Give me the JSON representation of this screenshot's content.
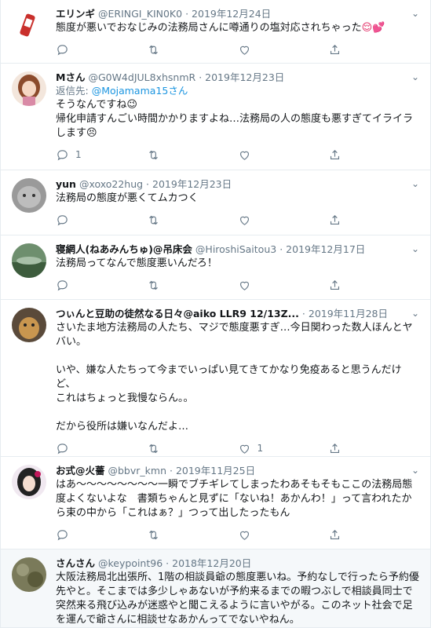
{
  "tweets": [
    {
      "name": "エリンギ",
      "handle": "@ERINGI_KIN0K0",
      "dot": "·",
      "date": "2019年12月24日",
      "reply_prefix": "",
      "reply_mention": "",
      "text": "態度が悪いでおなじみの法務局さんに噂通りの塩対応されちゃった",
      "emoji": "😌💕",
      "reply_count": "",
      "retweet_count": "",
      "like_count": "",
      "avatar_color": "#c9302c"
    },
    {
      "name": "Mさん",
      "handle": "@G0W4dJUL8xhsnmR",
      "dot": "·",
      "date": "2019年12月23日",
      "reply_prefix": "返信先: ",
      "reply_mention": "@Mojamama15さん",
      "text": "そうなんですね😉\n帰化申請すんごい時間かかりますよね…法務局の人の態度も悪すぎてイライラします😣",
      "emoji": "",
      "reply_count": "1",
      "retweet_count": "",
      "like_count": "",
      "avatar_color": "#a0522d"
    },
    {
      "name": "yun",
      "handle": "@xoxo22hug",
      "dot": "·",
      "date": "2019年12月23日",
      "reply_prefix": "",
      "reply_mention": "",
      "text": "法務局の態度が悪くてムカつく",
      "emoji": "",
      "reply_count": "",
      "retweet_count": "",
      "like_count": "",
      "avatar_color": "#8a8a8a"
    },
    {
      "name": "寝網人(ねあみんちゅ)@吊床会",
      "handle": "@HiroshiSaitou3",
      "dot": "·",
      "date": "2019年12月17日",
      "reply_prefix": "",
      "reply_mention": "",
      "text": "法務局ってなんで態度悪いんだろ！",
      "emoji": "",
      "reply_count": "",
      "retweet_count": "",
      "like_count": "",
      "avatar_color": "#4a7a4a"
    },
    {
      "name": "つぃんと豆助の徒然なる日々@aiko LLR9 12/13Z...",
      "handle": "",
      "dot": "·",
      "date": "2019年11月28日",
      "reply_prefix": "",
      "reply_mention": "",
      "text": "さいたま地方法務局の人たち、マジで態度悪すぎ…今日関わった数人ほんとヤバい。\n\nいや、嫌な人たちって今までいっぱい見てきてかなり免疫あると思うんだけど、\nこれはちょっと我慢ならん。。\n\nだから役所は嫌いなんだよ…",
      "emoji": "",
      "reply_count": "",
      "retweet_count": "",
      "like_count": "1",
      "avatar_color": "#b98a4a"
    },
    {
      "name": "お式@火薔",
      "handle": "@bbvr_kmn",
      "dot": "·",
      "date": "2019年11月25日",
      "reply_prefix": "",
      "reply_mention": "",
      "text": "はあ〜〜〜〜〜〜〜〜一瞬でブチギレてしまったわあそもそもここの法務局態度よくないよな　書類ちゃんと見ずに「ないね！あかんわ！」って言われたから束の中から「これはぁ？」つって出したったもん",
      "emoji": "",
      "reply_count": "",
      "retweet_count": "",
      "like_count": "",
      "avatar_color": "#333333"
    },
    {
      "name": "さんさん",
      "handle": "@keypoint96",
      "dot": "·",
      "date": "2018年12月20日",
      "reply_prefix": "",
      "reply_mention": "",
      "text": "大阪法務局北出張所、1階の相談員爺の態度悪いね。予約なしで行ったら予約優先やと。そこまでは多少しゃあないが予約来るまでの暇つぶしで相談員同士で突然来る飛び込みが迷惑やと聞こえるように言いやがる。このネット社会で足を運んで爺さんに相談せなあかんってでないやねん。",
      "emoji": "",
      "reply_count": "",
      "retweet_count": "",
      "like_count": "",
      "avatar_color": "#6b6b4a"
    }
  ]
}
